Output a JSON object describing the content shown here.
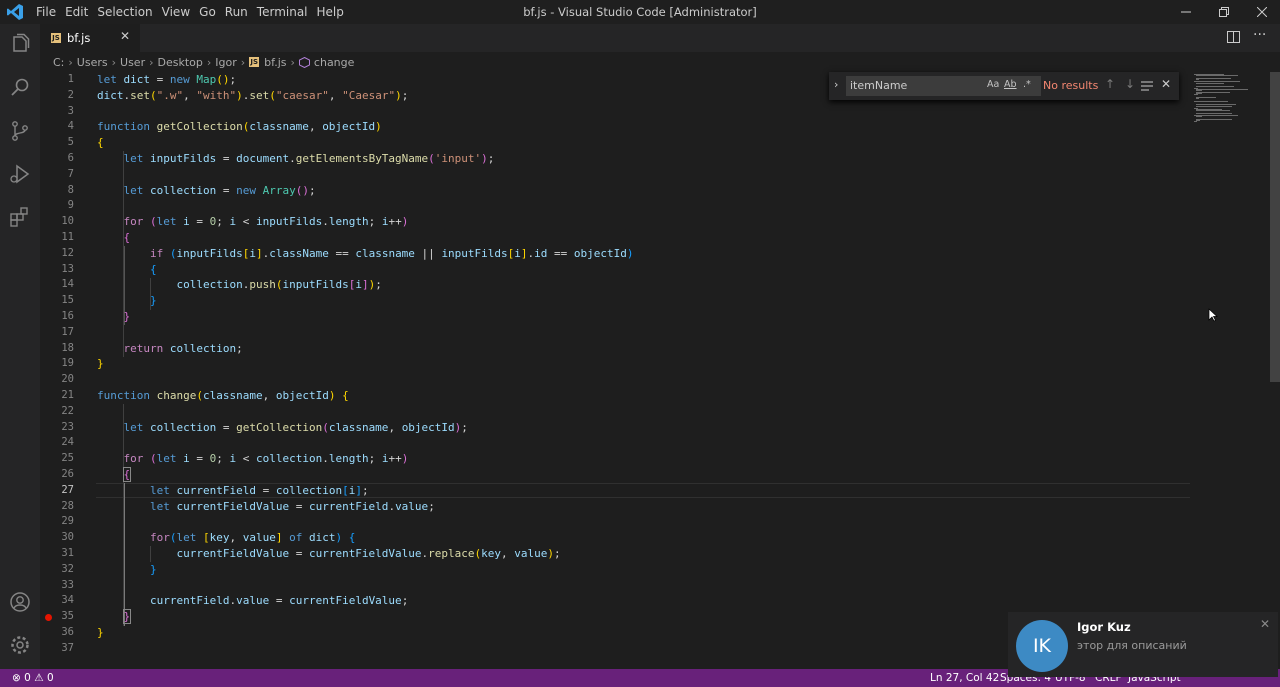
{
  "menu": [
    "File",
    "Edit",
    "Selection",
    "View",
    "Go",
    "Run",
    "Terminal",
    "Help"
  ],
  "window_title": "bf.js - Visual Studio Code [Administrator]",
  "tab": {
    "label": "bf.js",
    "badge": "JS"
  },
  "breadcrumb": {
    "path": [
      "C:",
      "Users",
      "User",
      "Desktop",
      "Igor"
    ],
    "file": "bf.js",
    "symbol": "change"
  },
  "find": {
    "value": "itemName",
    "case_label": "Aa",
    "word_label": "Ab",
    "regex_label": ".*",
    "result": "No results"
  },
  "line_numbers": [
    "1",
    "2",
    "3",
    "4",
    "5",
    "6",
    "7",
    "8",
    "9",
    "10",
    "11",
    "12",
    "13",
    "14",
    "15",
    "16",
    "17",
    "18",
    "19",
    "20",
    "21",
    "22",
    "23",
    "24",
    "25",
    "26",
    "27",
    "28",
    "29",
    "30",
    "31",
    "32",
    "33",
    "34",
    "35",
    "36",
    "37"
  ],
  "breakpoint_line": 35,
  "status": {
    "errors": "0",
    "warnings": "0",
    "position": "Ln 27, Col 42",
    "spaces": "Spaces: 4",
    "encoding": "UTF-8",
    "eol": "CRLF",
    "language": "JavaScript"
  },
  "notification": {
    "avatar": "IK",
    "name": "Igor Kuz",
    "message": "этор для описаний"
  },
  "colors": {
    "statusbar": "#68217a",
    "avatar": "#3d8ac4",
    "keyword": "#569cd6",
    "string": "#ce9178",
    "function": "#dcdcaa"
  }
}
